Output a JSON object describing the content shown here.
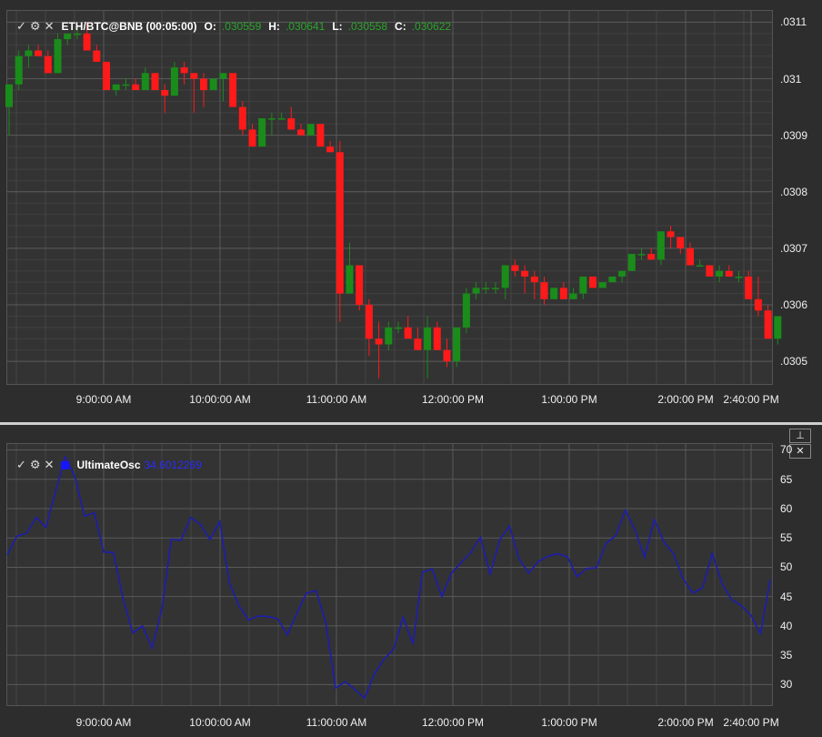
{
  "price": {
    "symbol": "ETH/BTC@BNB (00:05:00)",
    "o_label": "O:",
    "o_value": ".030559",
    "h_label": "H:",
    "h_value": ".030641",
    "l_label": "L:",
    "l_value": ".030558",
    "c_label": "C:",
    "c_value": ".030622",
    "y_ticks": [
      ".0311",
      ".031",
      ".0309",
      ".0308",
      ".0307",
      ".0306",
      ".0305"
    ],
    "ylim": [
      0.03046,
      0.03112
    ]
  },
  "x_ticks": [
    "9:00:00 AM",
    "10:00:00 AM",
    "11:00:00 AM",
    "12:00:00 PM",
    "1:00:00 PM",
    "2:00:00 PM",
    "2:40:00 PM"
  ],
  "osc": {
    "name": "UltimateOsc",
    "value": "34.6012269",
    "y_ticks": [
      "70",
      "65",
      "60",
      "55",
      "50",
      "45",
      "40",
      "35",
      "30"
    ],
    "ylim": [
      26.5,
      71
    ]
  },
  "icons": {
    "check": "check-icon",
    "gear": "gear-icon",
    "close": "close-icon",
    "pin": "pin-icon"
  },
  "colors": {
    "up": "#1a8c1a",
    "down": "#ff1a1a",
    "osc_line": "#1d1daf",
    "grid": "#4f4f4f"
  },
  "chart_data": [
    {
      "type": "candlestick",
      "title": "ETH/BTC@BNB (00:05:00)",
      "x_start": "8:05 AM",
      "interval_minutes": 5,
      "ohlc": [
        [
          0.03095,
          0.03099,
          0.0309,
          0.03099
        ],
        [
          0.03099,
          0.03105,
          0.03098,
          0.03104
        ],
        [
          0.03104,
          0.03106,
          0.03102,
          0.03105
        ],
        [
          0.03105,
          0.03106,
          0.03104,
          0.03104
        ],
        [
          0.03104,
          0.03105,
          0.03101,
          0.03101
        ],
        [
          0.03101,
          0.03108,
          0.03101,
          0.03107
        ],
        [
          0.03107,
          0.03108,
          0.03106,
          0.03108
        ],
        [
          0.03108,
          0.03109,
          0.03107,
          0.03108
        ],
        [
          0.03108,
          0.0311,
          0.03105,
          0.03105
        ],
        [
          0.03105,
          0.03106,
          0.03103,
          0.03103
        ],
        [
          0.03103,
          0.03103,
          0.03098,
          0.03098
        ],
        [
          0.03098,
          0.03099,
          0.03097,
          0.03099
        ],
        [
          0.03099,
          0.031,
          0.03098,
          0.03099
        ],
        [
          0.03099,
          0.031,
          0.03098,
          0.03098
        ],
        [
          0.03098,
          0.03102,
          0.03098,
          0.03101
        ],
        [
          0.03101,
          0.03101,
          0.03098,
          0.03098
        ],
        [
          0.03098,
          0.03099,
          0.03094,
          0.03097
        ],
        [
          0.03097,
          0.03103,
          0.03097,
          0.03102
        ],
        [
          0.03102,
          0.03103,
          0.03099,
          0.03101
        ],
        [
          0.03101,
          0.03101,
          0.03094,
          0.031
        ],
        [
          0.031,
          0.03101,
          0.03095,
          0.03098
        ],
        [
          0.03098,
          0.031,
          0.03098,
          0.031
        ],
        [
          0.031,
          0.03101,
          0.03096,
          0.03101
        ],
        [
          0.03101,
          0.03101,
          0.03095,
          0.03095
        ],
        [
          0.03095,
          0.03096,
          0.0309,
          0.03091
        ],
        [
          0.03091,
          0.03092,
          0.03088,
          0.03088
        ],
        [
          0.03088,
          0.03093,
          0.03088,
          0.03093
        ],
        [
          0.03093,
          0.03094,
          0.0309,
          0.03093
        ],
        [
          0.03093,
          0.03094,
          0.03093,
          0.03093
        ],
        [
          0.03093,
          0.03095,
          0.03091,
          0.03091
        ],
        [
          0.03091,
          0.03092,
          0.0309,
          0.0309
        ],
        [
          0.0309,
          0.03092,
          0.0309,
          0.03092
        ],
        [
          0.03092,
          0.03092,
          0.03088,
          0.03088
        ],
        [
          0.03088,
          0.03089,
          0.03087,
          0.03087
        ],
        [
          0.03087,
          0.03089,
          0.03057,
          0.03062
        ],
        [
          0.03062,
          0.03071,
          0.03062,
          0.03067
        ],
        [
          0.03067,
          0.03067,
          0.03059,
          0.0306
        ],
        [
          0.0306,
          0.03061,
          0.03051,
          0.03054
        ],
        [
          0.03054,
          0.03057,
          0.03047,
          0.03053
        ],
        [
          0.03053,
          0.03057,
          0.03052,
          0.03056
        ],
        [
          0.03056,
          0.03057,
          0.03055,
          0.03056
        ],
        [
          0.03056,
          0.03058,
          0.03054,
          0.03054
        ],
        [
          0.03054,
          0.03056,
          0.03052,
          0.03052
        ],
        [
          0.03052,
          0.03058,
          0.03047,
          0.03056
        ],
        [
          0.03056,
          0.03057,
          0.03052,
          0.03052
        ],
        [
          0.03052,
          0.03054,
          0.03049,
          0.0305
        ],
        [
          0.0305,
          0.03056,
          0.03049,
          0.03056
        ],
        [
          0.03056,
          0.03063,
          0.03055,
          0.03062
        ],
        [
          0.03062,
          0.03064,
          0.03061,
          0.03063
        ],
        [
          0.03063,
          0.03064,
          0.03062,
          0.03063
        ],
        [
          0.03063,
          0.03064,
          0.03062,
          0.03063
        ],
        [
          0.03063,
          0.03067,
          0.03061,
          0.03067
        ],
        [
          0.03067,
          0.03068,
          0.03065,
          0.03066
        ],
        [
          0.03066,
          0.03067,
          0.03062,
          0.03065
        ],
        [
          0.03065,
          0.03066,
          0.03061,
          0.03064
        ],
        [
          0.03064,
          0.03065,
          0.0306,
          0.03061
        ],
        [
          0.03061,
          0.03063,
          0.03061,
          0.03063
        ],
        [
          0.03063,
          0.03064,
          0.03061,
          0.03061
        ],
        [
          0.03061,
          0.03063,
          0.03061,
          0.03062
        ],
        [
          0.03062,
          0.03065,
          0.03061,
          0.03065
        ],
        [
          0.03065,
          0.03065,
          0.03063,
          0.03063
        ],
        [
          0.03063,
          0.03064,
          0.03063,
          0.03064
        ],
        [
          0.03064,
          0.03065,
          0.03064,
          0.03065
        ],
        [
          0.03065,
          0.03066,
          0.03064,
          0.03066
        ],
        [
          0.03066,
          0.03069,
          0.03066,
          0.03069
        ],
        [
          0.03069,
          0.0307,
          0.03068,
          0.03069
        ],
        [
          0.03069,
          0.0307,
          0.03068,
          0.03068
        ],
        [
          0.03068,
          0.03073,
          0.03067,
          0.03073
        ],
        [
          0.03073,
          0.03074,
          0.0307,
          0.03072
        ],
        [
          0.03072,
          0.03072,
          0.03069,
          0.0307
        ],
        [
          0.0307,
          0.03071,
          0.03067,
          0.03067
        ],
        [
          0.03067,
          0.03068,
          0.03067,
          0.03067
        ],
        [
          0.03067,
          0.03067,
          0.03065,
          0.03065
        ],
        [
          0.03065,
          0.03067,
          0.03064,
          0.03066
        ],
        [
          0.03066,
          0.03067,
          0.03065,
          0.03065
        ],
        [
          0.03065,
          0.03066,
          0.03064,
          0.03065
        ],
        [
          0.03065,
          0.03066,
          0.03061,
          0.03061
        ],
        [
          0.03061,
          0.03065,
          0.03058,
          0.03059
        ],
        [
          0.03059,
          0.0306,
          0.03055,
          0.03054
        ],
        [
          0.03054,
          0.03058,
          0.03053,
          0.03058
        ]
      ]
    },
    {
      "type": "line",
      "series": [
        {
          "name": "UltimateOsc",
          "values": [
            52.1,
            55.3,
            55.8,
            58.5,
            56.8,
            62.9,
            68.8,
            65.5,
            58.7,
            59.3,
            52.6,
            52.5,
            44.6,
            38.8,
            40.0,
            36.2,
            42.8,
            54.8,
            54.6,
            58.5,
            57.3,
            54.7,
            57.8,
            47.3,
            43.4,
            41.0,
            41.7,
            41.6,
            41.2,
            38.5,
            42.2,
            45.6,
            46.0,
            40.4,
            29.4,
            30.5,
            29.2,
            27.7,
            31.8,
            34.3,
            36.0,
            41.5,
            36.9,
            49.2,
            49.7,
            45.0,
            49.0,
            50.8,
            52.5,
            55.1,
            48.8,
            54.7,
            57.0,
            51.4,
            49.0,
            51.0,
            51.9,
            52.3,
            51.8,
            48.4,
            49.8,
            49.9,
            54.0,
            55.4,
            59.7,
            56.4,
            51.7,
            58.1,
            54.3,
            52.3,
            48.0,
            45.6,
            46.5,
            52.4,
            47.3,
            44.5,
            43.5,
            41.8,
            38.7,
            47.9
          ]
        }
      ],
      "ylim": [
        26.5,
        71
      ]
    }
  ]
}
